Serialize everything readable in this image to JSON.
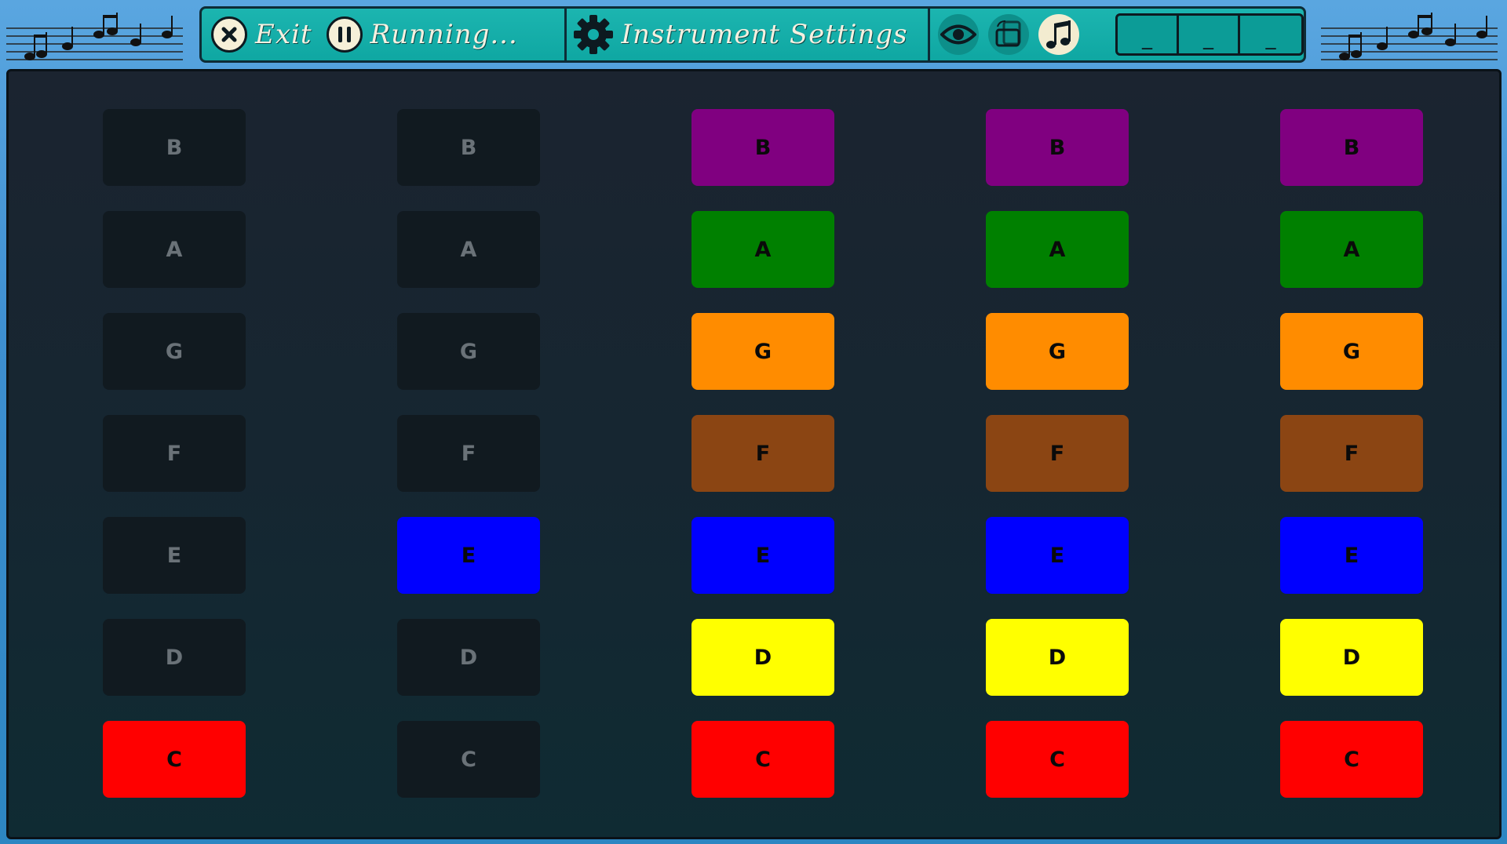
{
  "toolbar": {
    "exit_label": "Exit",
    "pause_label": "Running...",
    "settings_label": "Instrument Settings",
    "segments": [
      "_",
      "_",
      "_"
    ],
    "icons": {
      "exit": "close-circle-icon",
      "pause": "pause-circle-icon",
      "settings": "gear-icon",
      "view": "eye-icon",
      "rotate": "rotate-device-icon",
      "music": "music-note-icon"
    }
  },
  "colors": {
    "B": "#800080",
    "A": "#008000",
    "G": "#ff8c00",
    "F": "#8b4513",
    "E": "#0000ff",
    "D": "#ffff00",
    "C": "#ff0000"
  },
  "notes": [
    "B",
    "A",
    "G",
    "F",
    "E",
    "D",
    "C"
  ],
  "columns": [
    {
      "active": [
        "C"
      ]
    },
    {
      "active": [
        "E"
      ]
    },
    {
      "active": [
        "B",
        "A",
        "G",
        "F",
        "E",
        "D",
        "C"
      ]
    },
    {
      "active": [
        "B",
        "A",
        "G",
        "F",
        "E",
        "D",
        "C"
      ]
    },
    {
      "active": [
        "B",
        "A",
        "G",
        "F",
        "E",
        "D",
        "C"
      ]
    }
  ]
}
